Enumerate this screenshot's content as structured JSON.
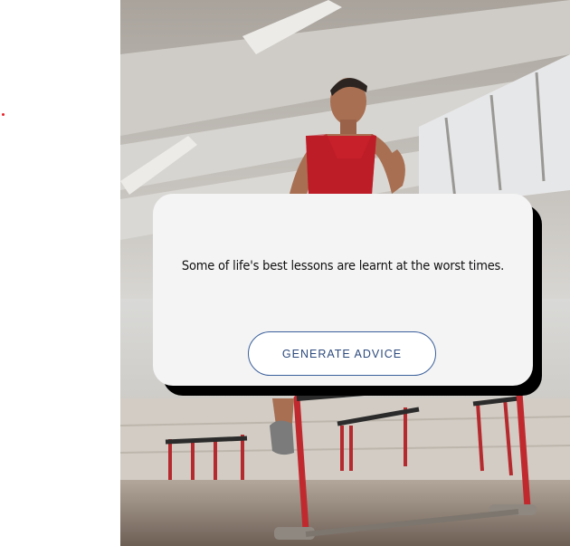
{
  "advice": {
    "text": "Some of life's best lessons are learnt at the worst times.",
    "button_label": "GENERATE ADVICE"
  },
  "colors": {
    "accent_dot": "#e8202a",
    "card_background": "#f4f4f5",
    "card_shadow": "#000000",
    "button_border": "#3a5f9b",
    "button_text": "#2c4a7d",
    "jersey": "#c8202b"
  },
  "image": {
    "subject": "athlete-jumping-hurdles"
  }
}
